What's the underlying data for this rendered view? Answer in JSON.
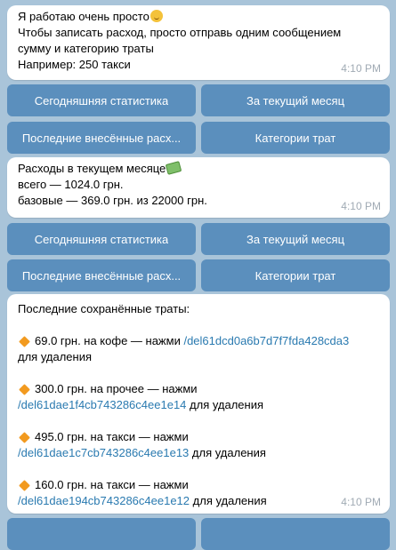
{
  "messages": [
    {
      "lines": [
        "Я работаю очень просто",
        "Чтобы записать расход, просто отправь одним сообщением",
        "сумму и категорию траты",
        "Например: 250 такси"
      ],
      "emoji": "smirking-face-icon",
      "time": "4:10 PM"
    },
    {
      "lines": [
        "Расходы в текущем месяце",
        "всего — 1024.0 грн.",
        "базовые — 369.0 грн. из 22000 грн."
      ],
      "emoji": "money-with-wings-icon",
      "time": "4:10 PM"
    },
    {
      "header": "Последние сохранённые траты:",
      "items": [
        {
          "text": "69.0 грн. на кофе — нажми ",
          "command": "/del61dcd0a6b7d7f7fda428cda3",
          "suffix": "для удаления"
        },
        {
          "text": "300.0 грн. на прочее — нажми",
          "command": "/del61dae1f4cb743286c4ee1e14",
          "suffix": " для удаления"
        },
        {
          "text": "495.0 грн. на такси — нажми",
          "command": "/del61dae1c7cb743286c4ee1e13",
          "suffix": " для удаления"
        },
        {
          "text": "160.0 грн. на такси — нажми",
          "command": "/del61dae194cb743286c4ee1e12",
          "suffix": " для удаления"
        }
      ],
      "time": "4:10 PM"
    }
  ],
  "keyboard": {
    "today_stats": "Сегодняшняя статистика",
    "current_month": "За текущий месяц",
    "last_entries": "Последние внесённые расх...",
    "categories": "Категории трат"
  },
  "colors": {
    "background": "#a9c4d9",
    "bubble": "#ffffff",
    "button": "#5b8fbd",
    "link": "#2a7ab0"
  }
}
